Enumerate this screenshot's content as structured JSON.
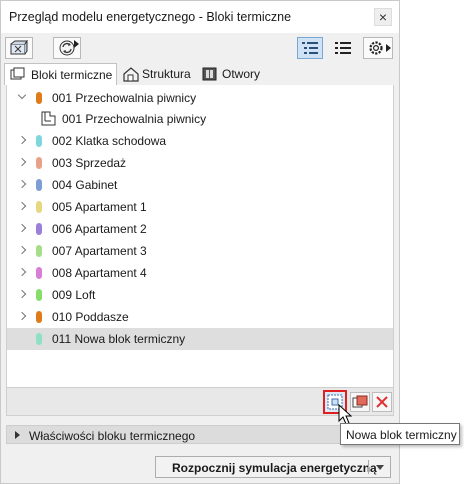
{
  "window": {
    "title": "Przegląd modelu energetycznego - Bloki termiczne",
    "close_glyph": "×"
  },
  "toolbar": {
    "left_buttons": [
      "model-view-icon",
      "refresh-icon"
    ],
    "right_buttons": [
      "list-view-icon",
      "list-icon",
      "settings-icon"
    ]
  },
  "tabs": [
    {
      "label": "Bloki termiczne",
      "icon": "thermal-block-icon",
      "active": true
    },
    {
      "label": "Struktura",
      "icon": "structure-house-icon",
      "active": false
    },
    {
      "label": "Otwory",
      "icon": "openings-icon",
      "active": false
    }
  ],
  "tree": {
    "rows": [
      {
        "label": "001 Przechowalnia piwnicy",
        "color": "#e07b1a",
        "expanded": true,
        "selected": false
      },
      {
        "label": "001 Przechowalnia piwnicy",
        "child": true
      },
      {
        "label": "002 Klatka schodowa",
        "color": "#7fd6dc",
        "expanded": false
      },
      {
        "label": "003 Sprzedaż",
        "color": "#e9a28a",
        "expanded": false
      },
      {
        "label": "004 Gabinet",
        "color": "#7e9cd6",
        "expanded": false
      },
      {
        "label": "005 Apartament 1",
        "color": "#e6d783",
        "expanded": false
      },
      {
        "label": "006 Apartament 2",
        "color": "#9c7fd9",
        "expanded": false
      },
      {
        "label": "007 Apartament 3",
        "color": "#a6dc8a",
        "expanded": false
      },
      {
        "label": "008 Apartament 4",
        "color": "#d77fd6",
        "expanded": false
      },
      {
        "label": "009 Loft",
        "color": "#86de69",
        "expanded": false
      },
      {
        "label": "010 Poddasze",
        "color": "#e07b1a",
        "expanded": false
      },
      {
        "label": "011 Nowa blok termiczny",
        "color": "#8fe0c6",
        "expanded": null,
        "selected": true
      }
    ]
  },
  "actions": [
    "new-block-icon",
    "assign-block-icon",
    "delete-icon"
  ],
  "properties_panel": {
    "label": "Właściwości bloku termicznego"
  },
  "simulate_button": {
    "label": "Rozpocznij symulacja energetyczną"
  },
  "tooltip": {
    "text": "Nowa blok termiczny"
  },
  "colors": {
    "selection": "#dedede",
    "highlight_border": "#e02020",
    "delete_red": "#e03030"
  }
}
